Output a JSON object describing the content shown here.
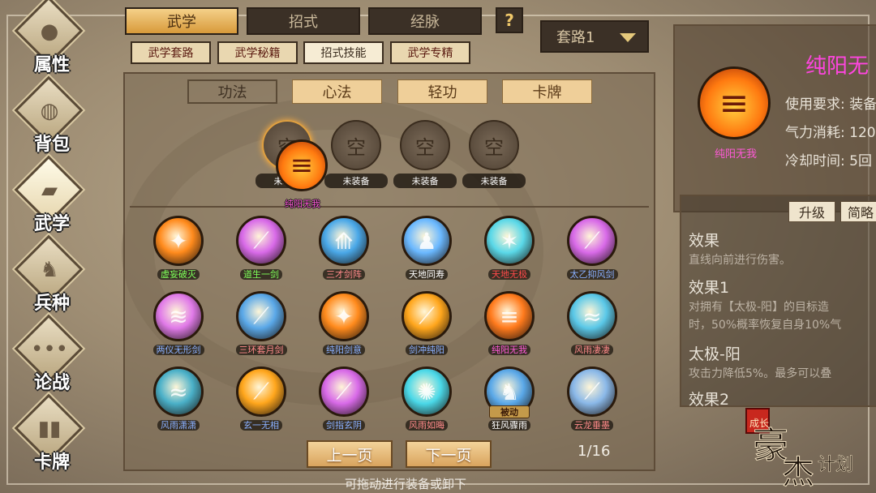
{
  "sidebar": {
    "items": [
      {
        "label": "属性",
        "icon": "person-icon",
        "glyph": "●"
      },
      {
        "label": "背包",
        "icon": "bag-icon",
        "glyph": "◍"
      },
      {
        "label": "武学",
        "icon": "book-icon",
        "glyph": "▰"
      },
      {
        "label": "兵种",
        "icon": "cavalry-icon",
        "glyph": "♞"
      },
      {
        "label": "论战",
        "icon": "chat-icon",
        "glyph": "•••"
      },
      {
        "label": "卡牌",
        "icon": "cards-icon",
        "glyph": "▮▮"
      }
    ]
  },
  "top_tabs": [
    "武学",
    "招式",
    "经脉"
  ],
  "help_label": "?",
  "sub_tabs": [
    "武学套路",
    "武学秘籍",
    "招式技能",
    "武学专精"
  ],
  "loadout": {
    "selected": "套路1"
  },
  "category_tabs": [
    "功法",
    "心法",
    "轻功",
    "卡牌"
  ],
  "equip_slots": [
    {
      "glyph": "空",
      "label": "未装备"
    },
    {
      "glyph": "空",
      "label": "未装备"
    },
    {
      "glyph": "空",
      "label": "未装备"
    },
    {
      "glyph": "空",
      "label": "未装备"
    }
  ],
  "dragged_skill": {
    "label": "纯阳无我"
  },
  "skills": [
    {
      "name": "虚妄破灭",
      "color": "#ff8a1c",
      "label_color": "#7fff5a",
      "glyph": "✦"
    },
    {
      "name": "道生一剑",
      "color": "#d86ae8",
      "label_color": "#7fff5a",
      "glyph": "⟋"
    },
    {
      "name": "三才剑阵",
      "color": "#4aa8e8",
      "label_color": "#ff8a8a",
      "glyph": "⟰"
    },
    {
      "name": "天地同寿",
      "color": "#6ab8ff",
      "label_color": "#ffffff",
      "glyph": "♟"
    },
    {
      "name": "天地无极",
      "color": "#5ad8e8",
      "label_color": "#ff4a4a",
      "glyph": "✶"
    },
    {
      "name": "太乙抑风剑",
      "color": "#d86ae8",
      "label_color": "#8ab0ff",
      "glyph": "⟋"
    },
    {
      "name": "两仪无形剑",
      "color": "#e07ae8",
      "label_color": "#8ab0ff",
      "glyph": "≋"
    },
    {
      "name": "三环套月剑",
      "color": "#5aa8e8",
      "label_color": "#ff8a8a",
      "glyph": "⟋"
    },
    {
      "name": "纯阳剑意",
      "color": "#ff8a1c",
      "label_color": "#8ab0ff",
      "glyph": "✦"
    },
    {
      "name": "剑冲纯阳",
      "color": "#ffa61c",
      "label_color": "#8ab0ff",
      "glyph": "⟋"
    },
    {
      "name": "纯阳无我",
      "color": "#ff7a1c",
      "label_color": "#ff5ad8",
      "glyph": "≡"
    },
    {
      "name": "风雨凄凄",
      "color": "#5ac8e8",
      "label_color": "#ff8a8a",
      "glyph": "≈"
    },
    {
      "name": "风雨潇潇",
      "color": "#4ab0c8",
      "label_color": "#8ab0ff",
      "glyph": "≈"
    },
    {
      "name": "玄一无相",
      "color": "#ffa61c",
      "label_color": "#8ab0ff",
      "glyph": "⟋"
    },
    {
      "name": "剑指玄阴",
      "color": "#d86ae8",
      "label_color": "#8ab0ff",
      "glyph": "⟋"
    },
    {
      "name": "风雨如晦",
      "color": "#4ad8e8",
      "label_color": "#ff8a8a",
      "glyph": "✺"
    },
    {
      "name": "狂风骤雨",
      "color": "#5aa8e8",
      "label_color": "#ffffff",
      "glyph": "♞",
      "badge": "被动"
    },
    {
      "name": "云龙垂墨",
      "color": "#8ab8e8",
      "label_color": "#ff8a8a",
      "glyph": "⟋"
    }
  ],
  "pagination": {
    "prev": "上一页",
    "next": "下一页",
    "count": "1/16"
  },
  "hint": "可拖动进行装备或卸下",
  "detail": {
    "name": "纯阳无",
    "icon_label": "纯阳无我",
    "requirement": "使用要求: 装备",
    "cost": "气力消耗: 120",
    "cooldown": "冷却时间: 5回",
    "buttons": [
      "升级",
      "简略"
    ],
    "effects": [
      {
        "title": "效果",
        "lines": [
          "直线向前进行伤害。"
        ]
      },
      {
        "title": "效果1",
        "lines": [
          "对拥有【太极-阳】的目标造",
          "时，50%概率恢复自身10%气"
        ]
      },
      {
        "title": "太极-阳",
        "lines": [
          "攻击力降低5%。最多可以叠"
        ]
      },
      {
        "title": "效果2",
        "lines": []
      }
    ]
  },
  "logo": {
    "text": "豪杰成长计划"
  }
}
